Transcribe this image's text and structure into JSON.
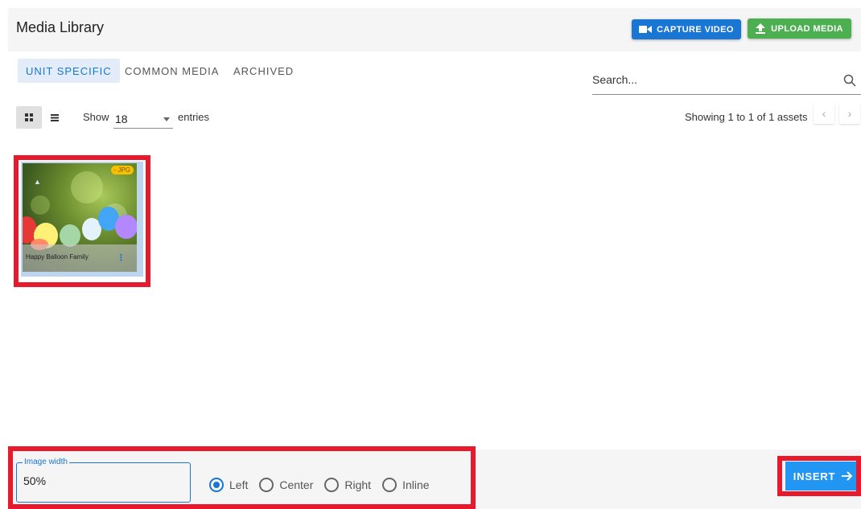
{
  "header": {
    "title": "Media Library",
    "capture_video_label": "CAPTURE VIDEO",
    "upload_media_label": "UPLOAD MEDIA"
  },
  "tabs": [
    {
      "label": "UNIT SPECIFIC",
      "active": true
    },
    {
      "label": "COMMON MEDIA",
      "active": false
    },
    {
      "label": "ARCHIVED",
      "active": false
    }
  ],
  "search": {
    "placeholder": "Search..."
  },
  "toolbar": {
    "show_label": "Show",
    "entries_value": "18",
    "entries_label": "entries",
    "showing_text": "Showing 1 to 1 of 1 assets",
    "prev_glyph": "‹",
    "next_glyph": "›"
  },
  "assets": [
    {
      "name": "Happy Balloon Family",
      "type_badge": "- JPG"
    }
  ],
  "footer": {
    "image_width_label": "Image width",
    "image_width_value": "50%",
    "alignment_options": [
      "Left",
      "Center",
      "Right",
      "Inline"
    ],
    "alignment_selected": "Left",
    "insert_label": "INSERT"
  },
  "colors": {
    "primary": "#1976d2",
    "upload_green": "#4caf50",
    "insert_blue": "#2196f3",
    "highlight_red": "#e8192c"
  }
}
